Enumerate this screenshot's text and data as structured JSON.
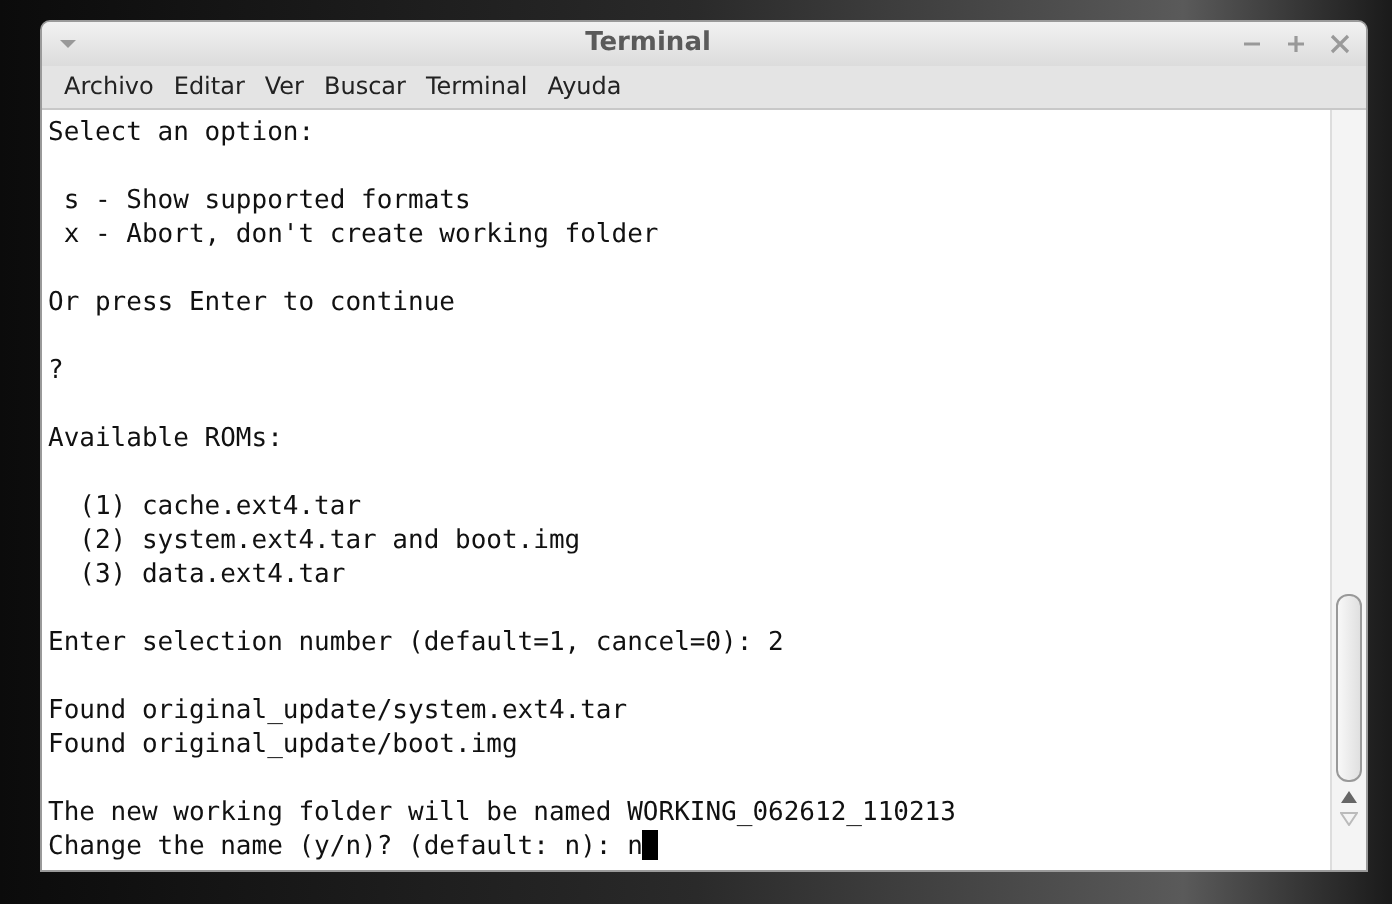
{
  "window": {
    "title": "Terminal"
  },
  "menu": [
    "Archivo",
    "Editar",
    "Ver",
    "Buscar",
    "Terminal",
    "Ayuda"
  ],
  "terminal": {
    "cursor": true,
    "paragraphs": [
      [
        "Select an option:"
      ],
      [
        " s - Show supported formats",
        " x - Abort, don't create working folder"
      ],
      [
        "Or press Enter to continue"
      ],
      [
        "?"
      ],
      [
        "Available ROMs:"
      ],
      [
        "  (1) cache.ext4.tar",
        "  (2) system.ext4.tar and boot.img",
        "  (3) data.ext4.tar"
      ],
      [
        "Enter selection number (default=1, cancel=0): 2"
      ],
      [
        "Found original_update/system.ext4.tar",
        "Found original_update/boot.img"
      ],
      [
        "The new working folder will be named WORKING_062612_110213",
        "Change the name (y/n)? (default: n): n"
      ]
    ]
  }
}
